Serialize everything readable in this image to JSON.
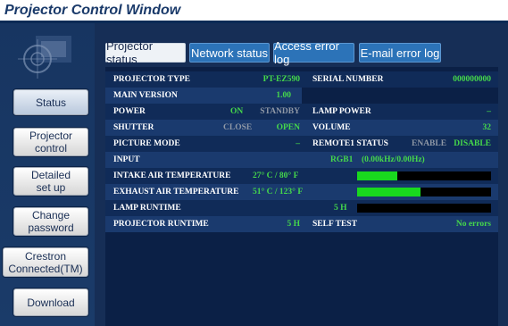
{
  "window": {
    "title": "Projector Control Window"
  },
  "nav": {
    "status": "Status",
    "projector_control": "Projector\ncontrol",
    "detailed_setup": "Detailed\nset up",
    "change_password": "Change\npassword",
    "crestron": "Crestron\nConnected(TM)",
    "download": "Download"
  },
  "tabs": {
    "projector_status": "Projector status",
    "network_status": "Network status",
    "access_error_log": "Access error log",
    "email_error_log": "E-mail error log"
  },
  "status": {
    "projector_type_label": "PROJECTOR TYPE",
    "projector_type_value": "PT-EZ590",
    "serial_label": "SERIAL NUMBER",
    "serial_value": "000000000",
    "main_version_label": "MAIN VERSION",
    "main_version_value": "1.00",
    "power_label": "POWER",
    "power_on": "ON",
    "power_standby": "STANDBY",
    "lamp_power_label": "LAMP POWER",
    "lamp_power_value": "–",
    "shutter_label": "SHUTTER",
    "shutter_close": "CLOSE",
    "shutter_open": "OPEN",
    "volume_label": "VOLUME",
    "volume_value": "32",
    "picture_mode_label": "PICTURE MODE",
    "picture_mode_value": "–",
    "remote_label": "REMOTE1 STATUS",
    "remote_enable": "ENABLE",
    "remote_disable": "DISABLE",
    "input_label": "INPUT",
    "input_value": "RGB1",
    "input_freq": "(0.00kHz/0.00Hz)",
    "intake_label": "INTAKE AIR TEMPERATURE",
    "intake_value": "27° C / 80° F",
    "intake_level": 0.3,
    "exhaust_label": "EXHAUST AIR TEMPERATURE",
    "exhaust_value": "51° C / 123° F",
    "exhaust_level": 0.47,
    "lamp_runtime_label": "LAMP RUNTIME",
    "lamp_runtime_value": "5 H",
    "lamp_runtime_level": 0.0,
    "projector_runtime_label": "PROJECTOR RUNTIME",
    "projector_runtime_value": "5 H",
    "self_test_label": "SELF TEST",
    "self_test_value": "No errors"
  },
  "colors": {
    "value_green": "#45d84b",
    "inactive_gray": "#8f98a6",
    "bar_fill": "#19d81e",
    "tab_blue": "#2c73b8"
  }
}
